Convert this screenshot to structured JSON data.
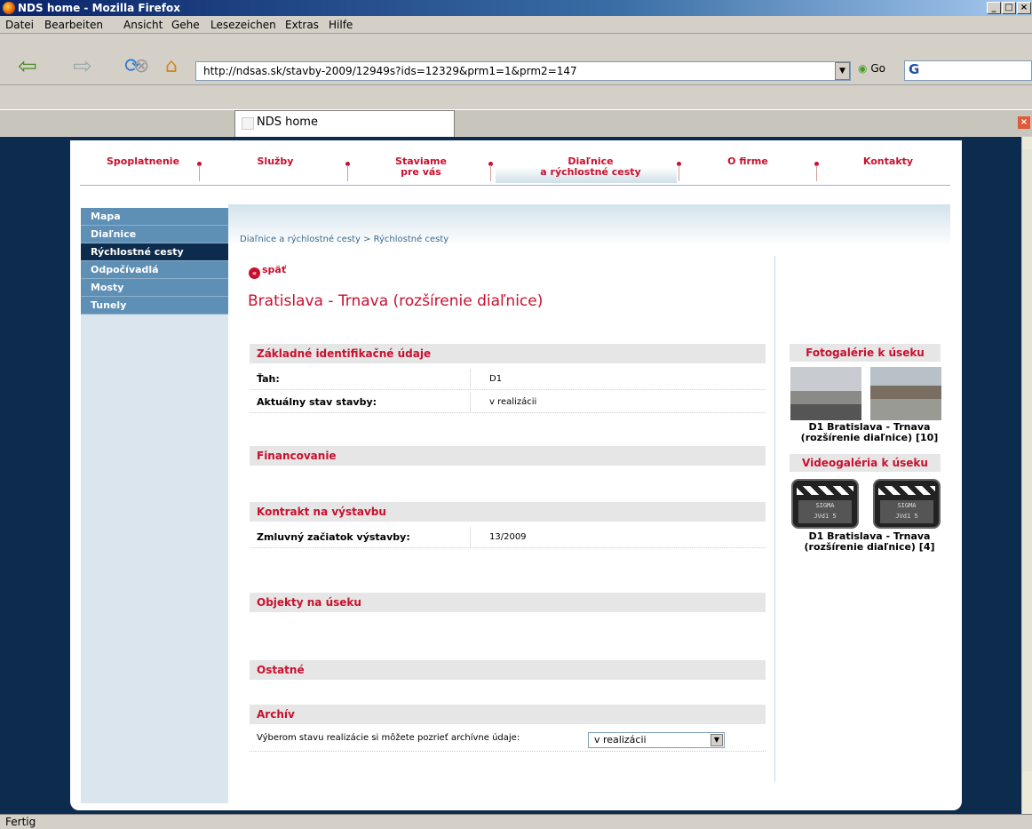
{
  "window": {
    "title": "NDS home - Mozilla Firefox"
  },
  "menu": [
    "Datei",
    "Bearbeiten",
    "Ansicht",
    "Gehe",
    "Lesezeichen",
    "Extras",
    "Hilfe"
  ],
  "toolbar": {
    "url": "http://ndsas.sk/stavby-2009/12949s?ids=12329&prm1=1&prm2=147",
    "go_label": "Go"
  },
  "tab": {
    "title": "NDS home"
  },
  "status": {
    "text": "Fertig"
  },
  "colors": {
    "accent": "#c8102e",
    "sidebar": "#5e8fb5",
    "sidebar_active": "#0d2b4c",
    "page_bg": "#0d2b4c"
  },
  "site_nav": [
    {
      "label": "Spoplatnenie"
    },
    {
      "label": "Služby"
    },
    {
      "label": "Staviame\npre vás"
    },
    {
      "label": "Diaľnice\na rýchlostné cesty",
      "active": true
    },
    {
      "label": "O firme"
    },
    {
      "label": "Kontakty"
    }
  ],
  "sidebar": {
    "items": [
      {
        "label": "Mapa"
      },
      {
        "label": "Diaľnice"
      },
      {
        "label": "Rýchlostné cesty",
        "active": true
      },
      {
        "label": "Odpočívadlá"
      },
      {
        "label": "Mosty"
      },
      {
        "label": "Tunely"
      }
    ]
  },
  "main": {
    "breadcrumb": "Diaľnice a rýchlostné cesty > Rýchlostné cesty",
    "back_label": "späť",
    "title": "Bratislava - Trnava (rozšírenie diaľnice)",
    "sections": {
      "basic": {
        "title": "Základné identifikačné údaje",
        "rows": [
          {
            "key": "Ťah:",
            "value": "D1"
          },
          {
            "key": "Aktuálny stav stavby:",
            "value": "v realizácii"
          }
        ]
      },
      "financing": {
        "title": "Financovanie"
      },
      "contract": {
        "title": "Kontrakt na výstavbu",
        "rows": [
          {
            "key": "Zmluvný začiatok výstavby:",
            "value": "13/2009"
          }
        ]
      },
      "objects": {
        "title": "Objekty na úseku"
      },
      "other": {
        "title": "Ostatné"
      },
      "archive": {
        "title": "Archív",
        "text": "Výberom stavu realizácie si môžete pozrieť archívne údaje:",
        "select_value": "v realizácii"
      }
    }
  },
  "right": {
    "photo_title": "Fotogalérie k úseku",
    "photo_caption": "D1 Bratislava - Trnava (rozšírenie diaľnice) [10]",
    "video_title": "Videogaléria k úseku",
    "video_caption": "D1 Bratislava - Trnava (rozšírenie diaľnice) [4]"
  }
}
